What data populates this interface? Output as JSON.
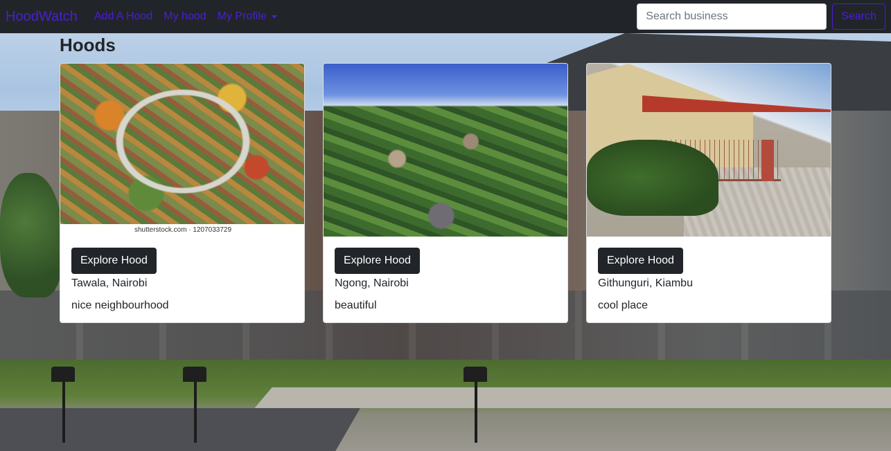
{
  "nav": {
    "brand": "HoodWatch",
    "links": [
      "Add A Hood",
      "My hood"
    ],
    "profile_label": "My Profile",
    "search_placeholder": "Search business",
    "search_button": "Search"
  },
  "page_title": "Hoods",
  "cards": [
    {
      "button": "Explore Hood",
      "location": "Tawala, Nairobi",
      "description": "nice neighbourhood",
      "image_caption": "shutterstock.com · 1207033729"
    },
    {
      "button": "Explore Hood",
      "location": "Ngong, Nairobi",
      "description": "beautiful"
    },
    {
      "button": "Explore Hood",
      "location": "Githunguri, Kiambu",
      "description": "cool place"
    }
  ],
  "colors": {
    "navbar_bg": "#212529",
    "nav_link": "#4a1fd1",
    "button_dark": "#212529"
  }
}
